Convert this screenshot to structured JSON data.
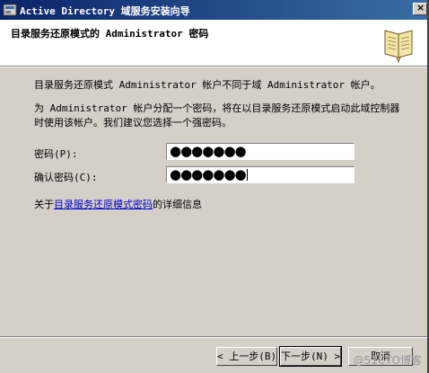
{
  "window": {
    "title": "Active Directory 域服务安装向导",
    "icons": {
      "app": "ad-wizard-icon",
      "close": "close-icon"
    }
  },
  "header": {
    "title": "目录服务还原模式的 Administrator 密码",
    "icon": "book-icon"
  },
  "body": {
    "paragraph1": "目录服务还原模式 Administrator 帐户不同于域 Administrator 帐户。",
    "paragraph2": "为 Administrator 帐户分配一个密码，将在以目录服务还原模式启动此域控制器时使用该帐户。我们建议您选择一个强密码。"
  },
  "form": {
    "password_label": "密码(P):",
    "password_value": "●●●●●●●",
    "confirm_label": "确认密码(C):",
    "confirm_value": "●●●●●●●"
  },
  "info": {
    "prefix": "关于",
    "link_text": "目录服务还原模式密码",
    "suffix": "的详细信息"
  },
  "buttons": {
    "back": "< 上一步(B)",
    "next": "下一步(N) >",
    "cancel": "取消"
  },
  "watermark": "@51CTO博客"
}
